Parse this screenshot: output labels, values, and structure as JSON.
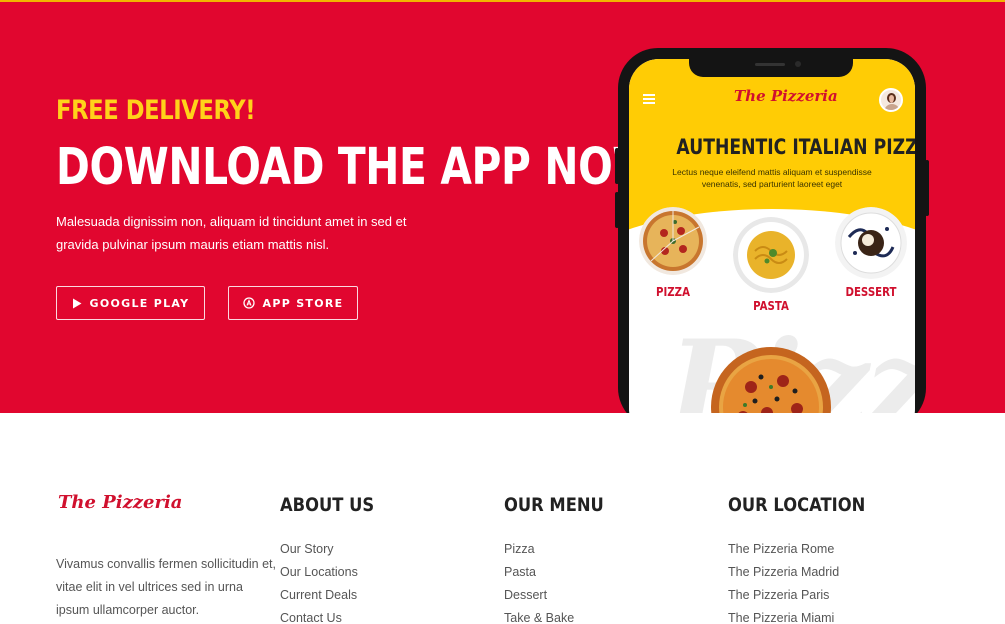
{
  "hero": {
    "eyebrow": "FREE DELIVERY!",
    "title": "DOWNLOAD THE APP NOW!",
    "description": "Malesuada dignissim non, aliquam id tincidunt amet in sed et gravida pulvinar ipsum mauris etiam mattis nisl.",
    "buttons": {
      "google_play": "GOOGLE PLAY",
      "app_store": "APP STORE"
    },
    "colors": {
      "background": "#e1062f",
      "eyebrow": "#ffd21a"
    }
  },
  "phone": {
    "logo": "The Pizzeria",
    "heading": "AUTHENTIC ITALIAN PIZZERIA",
    "subtext": "Lectus neque eleifend mattis aliquam et suspendisse venenatis, sed parturient laoreet eget",
    "categories": [
      {
        "label": "PIZZA"
      },
      {
        "label": "PASTA"
      },
      {
        "label": "DESSERT"
      }
    ],
    "background_word": "Pizza",
    "colors": {
      "screen_top": "#ffcc05",
      "accent": "#d0102e"
    }
  },
  "footer": {
    "logo": "The Pizzeria",
    "text": "Vivamus convallis fermen sollicitudin et, vitae elit in vel ultrices sed in urna ipsum ullamcorper auctor.",
    "columns": [
      {
        "heading": "ABOUT US",
        "links": [
          "Our Story",
          "Our Locations",
          "Current Deals",
          "Contact Us"
        ]
      },
      {
        "heading": "OUR MENU",
        "links": [
          "Pizza",
          "Pasta",
          "Dessert",
          "Take & Bake"
        ]
      },
      {
        "heading": "OUR LOCATION",
        "links": [
          "The Pizzeria Rome",
          "The Pizzeria Madrid",
          "The Pizzeria Paris",
          "The Pizzeria Miami"
        ]
      }
    ]
  }
}
